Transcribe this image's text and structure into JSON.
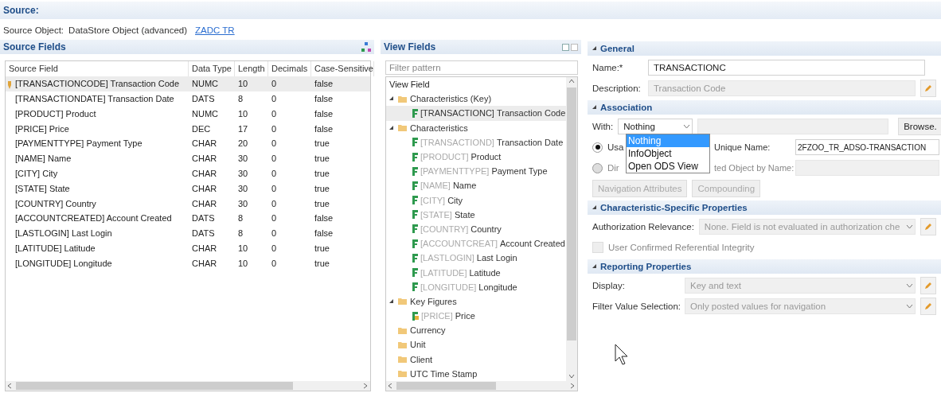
{
  "source": {
    "title": "Source:",
    "object_label": "Source Object:",
    "object_type": "DataStore Object (advanced)",
    "object_link": "ZADC TR"
  },
  "source_fields": {
    "title": "Source Fields",
    "columns": [
      "Source Field",
      "Data Type",
      "Length",
      "Decimals",
      "Case-Sensitive"
    ],
    "rows": [
      {
        "key": true,
        "selected": true,
        "cells": [
          "[TRANSACTIONCODE] Transaction Code",
          "NUMC",
          "10",
          "0",
          "false"
        ]
      },
      {
        "key": false,
        "selected": false,
        "cells": [
          "[TRANSACTIONDATE] Transaction Date",
          "DATS",
          "8",
          "0",
          "false"
        ]
      },
      {
        "key": false,
        "selected": false,
        "cells": [
          "[PRODUCT] Product",
          "NUMC",
          "10",
          "0",
          "false"
        ]
      },
      {
        "key": false,
        "selected": false,
        "cells": [
          "[PRICE] Price",
          "DEC",
          "17",
          "0",
          "false"
        ]
      },
      {
        "key": false,
        "selected": false,
        "cells": [
          "[PAYMENTTYPE] Payment Type",
          "CHAR",
          "20",
          "0",
          "true"
        ]
      },
      {
        "key": false,
        "selected": false,
        "cells": [
          "[NAME] Name",
          "CHAR",
          "30",
          "0",
          "true"
        ]
      },
      {
        "key": false,
        "selected": false,
        "cells": [
          "[CITY] City",
          "CHAR",
          "30",
          "0",
          "true"
        ]
      },
      {
        "key": false,
        "selected": false,
        "cells": [
          "[STATE] State",
          "CHAR",
          "30",
          "0",
          "true"
        ]
      },
      {
        "key": false,
        "selected": false,
        "cells": [
          "[COUNTRY] Country",
          "CHAR",
          "30",
          "0",
          "true"
        ]
      },
      {
        "key": false,
        "selected": false,
        "cells": [
          "[ACCOUNTCREATED] Account Created",
          "DATS",
          "8",
          "0",
          "false"
        ]
      },
      {
        "key": false,
        "selected": false,
        "cells": [
          "[LASTLOGIN] Last Login",
          "DATS",
          "8",
          "0",
          "false"
        ]
      },
      {
        "key": false,
        "selected": false,
        "cells": [
          "[LATITUDE] Latitude",
          "CHAR",
          "10",
          "0",
          "true"
        ]
      },
      {
        "key": false,
        "selected": false,
        "cells": [
          "[LONGITUDE] Longitude",
          "CHAR",
          "10",
          "0",
          "true"
        ]
      }
    ]
  },
  "view_fields": {
    "title": "View Fields",
    "filter": {
      "placeholder": "Filter pattern"
    },
    "column": "View Field",
    "tree": [
      {
        "kind": "folder",
        "label": "Characteristics (Key)",
        "expanded": true,
        "children": [
          {
            "kind": "characteristic",
            "tech": "[TRANSACTIONC]",
            "label": "Transaction Code",
            "greyed": false,
            "selected": true
          }
        ]
      },
      {
        "kind": "folder",
        "label": "Characteristics",
        "expanded": true,
        "children": [
          {
            "kind": "characteristic",
            "tech": "[TRANSACTIOND]",
            "label": "Transaction Date",
            "greyed": true,
            "selected": false
          },
          {
            "kind": "characteristic",
            "tech": "[PRODUCT]",
            "label": "Product",
            "greyed": true,
            "selected": false
          },
          {
            "kind": "characteristic",
            "tech": "[PAYMENTTYPE]",
            "label": "Payment Type",
            "greyed": true,
            "selected": false
          },
          {
            "kind": "characteristic",
            "tech": "[NAME]",
            "label": "Name",
            "greyed": true,
            "selected": false
          },
          {
            "kind": "characteristic",
            "tech": "[CITY]",
            "label": "City",
            "greyed": true,
            "selected": false
          },
          {
            "kind": "characteristic",
            "tech": "[STATE]",
            "label": "State",
            "greyed": true,
            "selected": false
          },
          {
            "kind": "characteristic",
            "tech": "[COUNTRY]",
            "label": "Country",
            "greyed": true,
            "selected": false
          },
          {
            "kind": "characteristic",
            "tech": "[ACCOUNTCREAT]",
            "label": "Account Created",
            "greyed": true,
            "selected": false
          },
          {
            "kind": "characteristic",
            "tech": "[LASTLOGIN]",
            "label": "Last Login",
            "greyed": true,
            "selected": false
          },
          {
            "kind": "characteristic",
            "tech": "[LATITUDE]",
            "label": "Latitude",
            "greyed": true,
            "selected": false
          },
          {
            "kind": "characteristic",
            "tech": "[LONGITUDE]",
            "label": "Longitude",
            "greyed": true,
            "selected": false
          }
        ]
      },
      {
        "kind": "folder",
        "label": "Key Figures",
        "expanded": true,
        "children": [
          {
            "kind": "key_figure",
            "tech": "[PRICE]",
            "label": "Price",
            "greyed": true,
            "selected": false
          }
        ]
      },
      {
        "kind": "folder",
        "label": "Currency",
        "expanded": false
      },
      {
        "kind": "folder",
        "label": "Unit",
        "expanded": false
      },
      {
        "kind": "folder",
        "label": "Client",
        "expanded": false
      },
      {
        "kind": "folder",
        "label": "UTC Time Stamp",
        "expanded": false
      }
    ]
  },
  "general": {
    "title": "General",
    "name_label": "Name:*",
    "name_value": "TRANSACTIONC",
    "description_label": "Description:",
    "description_value": "Transaction Code"
  },
  "association": {
    "title": "Association",
    "with_label": "With:",
    "with_value": "Nothing",
    "browse": "Browse.",
    "options": [
      {
        "label": "Nothing",
        "selected": true
      },
      {
        "label": "InfoObject",
        "selected": false
      },
      {
        "label": "Open ODS View",
        "selected": false
      }
    ],
    "radios": [
      {
        "label_start": "Usa",
        "label_end": "Unique Name:",
        "value": "2FZOO_TR_ADSO-TRANSACTION",
        "selected": true,
        "disabled": false
      },
      {
        "label_start": "Dir",
        "label_end": "ted Object by Name:",
        "selected": false,
        "disabled": true
      }
    ],
    "buttons": [
      "Navigation Attributes",
      "Compounding"
    ]
  },
  "char_props": {
    "title": "Characteristic-Specific Properties",
    "auth_label": "Authorization Relevance:",
    "auth_value": "None. Field is not evaluated in authorization che",
    "checkbox": {
      "label": "User Confirmed Referential Integrity",
      "checked": false,
      "disabled": true
    }
  },
  "reporting": {
    "title": "Reporting Properties",
    "fields": [
      {
        "label": "Display:",
        "value": "Key and text"
      },
      {
        "label": "Filter Value Selection:",
        "value": "Only posted values for navigation"
      }
    ]
  }
}
